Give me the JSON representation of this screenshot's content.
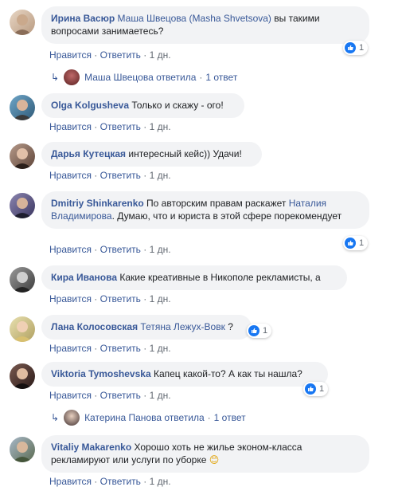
{
  "comments": [
    {
      "author": "Ирина Васюр",
      "mention": "Маша Швецова (Masha Shvetsova)",
      "text": " вы такими вопросами занимаетесь?",
      "like": "Нравится",
      "reply": "Ответить",
      "time": "1 дн.",
      "reactions": "1"
    },
    {
      "author": "Olga Kolgusheva",
      "text": " Только и скажу - ого!",
      "like": "Нравится",
      "reply": "Ответить",
      "time": "1 дн."
    },
    {
      "author": "Дарья Кутецкая",
      "text": " интересный кейс)) Удачи!",
      "like": "Нравится",
      "reply": "Ответить",
      "time": "1 дн."
    },
    {
      "author": "Dmitriy Shinkarenko",
      "text_before": " По авторским правам раскажет ",
      "mention": "Наталия Владимирова",
      "text": ". Думаю, что и юриста в этой сфере порекомендует",
      "like": "Нравится",
      "reply": "Ответить",
      "time": "1 дн.",
      "reactions": "1"
    },
    {
      "author": "Кира Иванова",
      "text": " Какие креативные в Никополе рекламисты, а",
      "like": "Нравится",
      "reply": "Ответить",
      "time": "1 дн."
    },
    {
      "author": "Лана Колосовская",
      "mention": "Тетяна Лежух-Вовк",
      "text": " ?",
      "like": "Нравится",
      "reply": "Ответить",
      "time": "1 дн.",
      "reactions": "1"
    },
    {
      "author": "Viktoria Tymoshevska",
      "text": " Капец какой-то? А как ты нашла?",
      "like": "Нравится",
      "reply": "Ответить",
      "time": "1 дн.",
      "reactions": "1"
    },
    {
      "author": "Vitaliy Makarenko",
      "text": " Хорошо хоть не жилье эконом-класса рекламируют или услуги по уборке",
      "emoji": "😊",
      "like": "Нравится",
      "reply": "Ответить",
      "time": "1 дн."
    }
  ],
  "replies": [
    {
      "name": "Маша Швецова",
      "action": "ответила",
      "count": "1 ответ"
    },
    {
      "name": "Катерина Панова",
      "action": "ответила",
      "count": "1 ответ"
    }
  ],
  "separator": "·",
  "colors": {
    "link": "#385898",
    "bubble": "#f2f3f5",
    "meta": "#606770",
    "like": "#1877f2"
  }
}
